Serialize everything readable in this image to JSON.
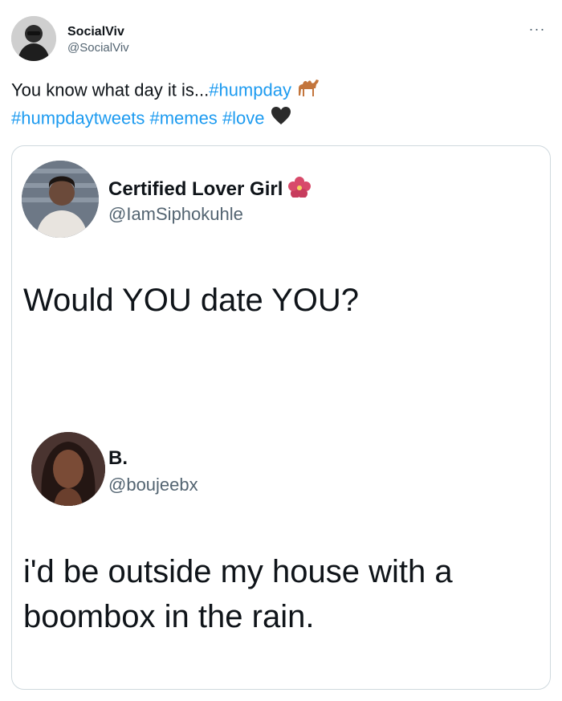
{
  "tweet": {
    "author_name": "SocialViv",
    "author_handle": "@SocialViv",
    "more_label": "···",
    "text_prefix": "You know what day it is...",
    "hashtags_line1": [
      "#humpday"
    ],
    "hashtags_line2": [
      "#humpdaytweets",
      "#memes",
      "#love"
    ],
    "emoji_1": "camel-emoji",
    "emoji_2": "black-heart-emoji",
    "colors": {
      "link": "#1d9bf0",
      "text": "#0f1419",
      "muted": "#536471",
      "border": "#cfd9de"
    }
  },
  "media": {
    "post1": {
      "name": "Certified Lover Girl",
      "name_emoji": "hibiscus-emoji",
      "handle": "@IamSiphokuhle",
      "body": "Would YOU date YOU?"
    },
    "post2": {
      "name": "B.",
      "handle": "@boujeebx",
      "body_line1": "i'd be outside my house with a",
      "body_line2": "boombox in the rain."
    }
  }
}
